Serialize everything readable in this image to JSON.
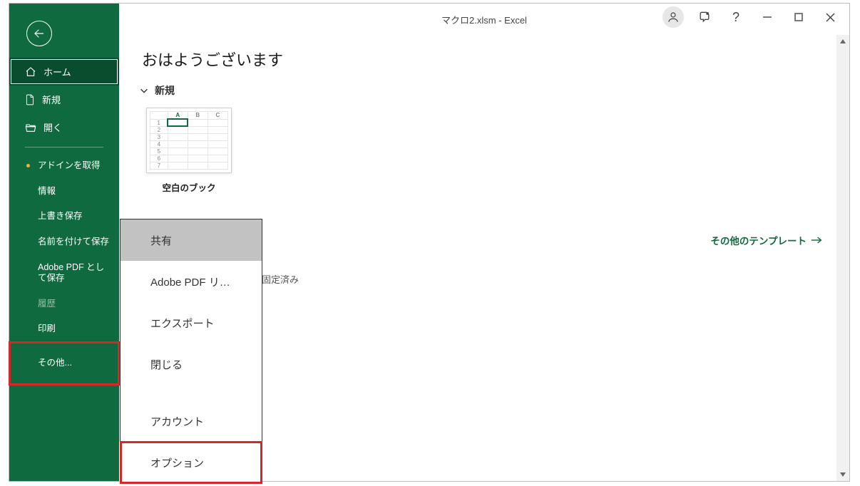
{
  "window": {
    "title": "マクロ2.xlsm  -  Excel"
  },
  "sidebar": {
    "home": "ホーム",
    "new": "新規",
    "open": "開く",
    "secondary": [
      {
        "label": "アドインを取得",
        "dot": true
      },
      {
        "label": "情報"
      },
      {
        "label": "上書き保存"
      },
      {
        "label": "名前を付けて保存"
      },
      {
        "label": "Adobe PDF として保存"
      },
      {
        "label": "履歴",
        "disabled": true
      },
      {
        "label": "印刷"
      },
      {
        "label": "その他...",
        "highlight": true
      }
    ]
  },
  "main": {
    "greeting": "おはようございます",
    "new_section": "新規",
    "blank_workbook": "空白のブック",
    "more_templates": "その他のテンプレート",
    "pinned_section_label": "固定済み"
  },
  "flyout": {
    "items": [
      {
        "label": "共有",
        "focused": true
      },
      {
        "label": "Adobe PDF リ…"
      },
      {
        "label": "エクスポート"
      },
      {
        "label": "閉じる"
      },
      {
        "gap": true
      },
      {
        "label": "アカウント"
      },
      {
        "label": "オプション",
        "highlight": true
      }
    ]
  }
}
